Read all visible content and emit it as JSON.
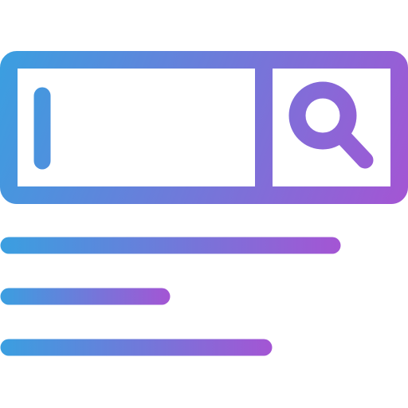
{
  "illustration": {
    "kind": "search-bar-with-results-icon",
    "colors": {
      "gradient_start": "#3a9fe0",
      "gradient_end": "#a455d4",
      "background": "#ffffff"
    },
    "search_bar": {
      "input_state": "empty-with-text-cursor",
      "button_icon": "magnifier-icon"
    },
    "result_lines_count": 3
  }
}
